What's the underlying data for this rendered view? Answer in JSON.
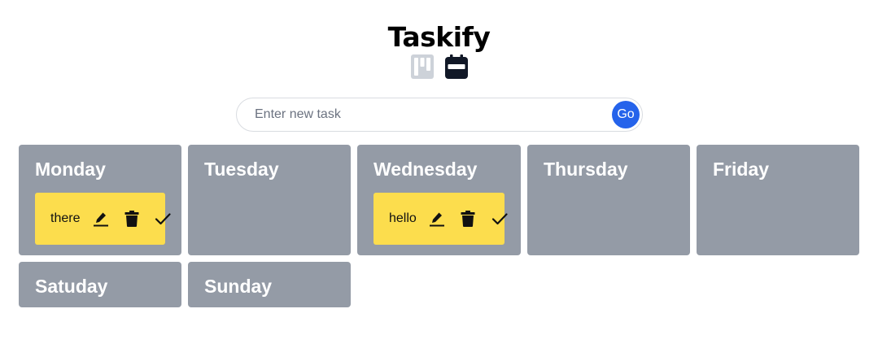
{
  "app": {
    "title": "Taskify"
  },
  "view_switch": [
    {
      "icon": "kanban-board-icon",
      "state": "inactive"
    },
    {
      "icon": "calendar-icon",
      "state": "active"
    }
  ],
  "task_form": {
    "placeholder": "Enter new task",
    "value": "",
    "submit_label": "Go"
  },
  "days": [
    {
      "name": "Monday",
      "tasks": [
        {
          "text": "there"
        }
      ]
    },
    {
      "name": "Tuesday",
      "tasks": []
    },
    {
      "name": "Wednesday",
      "tasks": [
        {
          "text": "hello"
        }
      ]
    },
    {
      "name": "Thursday",
      "tasks": []
    },
    {
      "name": "Friday",
      "tasks": []
    },
    {
      "name": "Satuday",
      "tasks": []
    },
    {
      "name": "Sunday",
      "tasks": []
    }
  ],
  "task_actions": [
    {
      "icon": "edit-icon"
    },
    {
      "icon": "delete-icon"
    },
    {
      "icon": "done-check-icon"
    }
  ],
  "colors": {
    "column_bg": "#949ba6",
    "task_bg": "#fcdd4d",
    "accent": "#2563eb",
    "icon_inactive": "#cdd2d9",
    "icon_active": "#111827"
  }
}
